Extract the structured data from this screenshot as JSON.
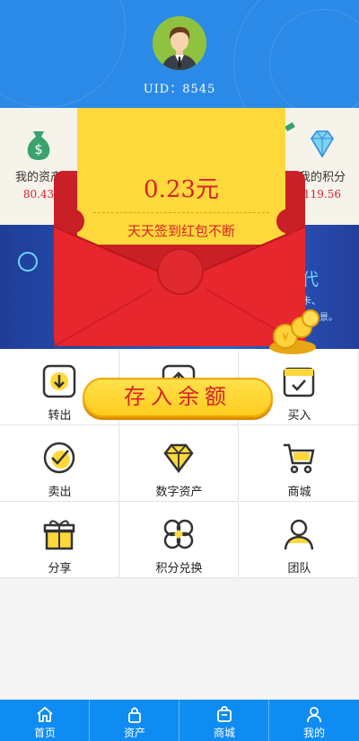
{
  "header": {
    "uid_text": "UID：8545"
  },
  "stats": {
    "left": {
      "label": "我的资产",
      "value": "80.43",
      "icon": "money-bag-icon"
    },
    "right": {
      "label": "我的积分",
      "value": "119.56",
      "icon": "diamond-icon"
    }
  },
  "banner": {
    "title": "代",
    "line1": "卡、",
    "line2": "等场景。"
  },
  "grid": {
    "items": [
      {
        "label": "转出",
        "icon": "withdraw-icon"
      },
      {
        "label": "",
        "icon": "upload-icon"
      },
      {
        "label": "买入",
        "icon": "buy-icon"
      },
      {
        "label": "卖出",
        "icon": "sell-check-icon"
      },
      {
        "label": "数字资产",
        "icon": "diamond-icon"
      },
      {
        "label": "商城",
        "icon": "cart-icon"
      },
      {
        "label": "分享",
        "icon": "gift-icon"
      },
      {
        "label": "积分兑换",
        "icon": "exchange-icon"
      },
      {
        "label": "团队",
        "icon": "team-icon"
      }
    ]
  },
  "popup": {
    "amount": "0.23元",
    "slogan": "天天签到红包不断",
    "deposit_label": "存入余额"
  },
  "tabbar": {
    "items": [
      {
        "label": "首页",
        "icon": "home-icon"
      },
      {
        "label": "资产",
        "icon": "lock-icon"
      },
      {
        "label": "商城",
        "icon": "shop-bag-icon"
      },
      {
        "label": "我的",
        "icon": "user-icon"
      }
    ]
  },
  "colors": {
    "primary": "#2b8ae8",
    "tabbar": "#0f8cf2",
    "red": "#d8232a",
    "yellow": "#ffd83b",
    "envelope": "#e8262d"
  }
}
